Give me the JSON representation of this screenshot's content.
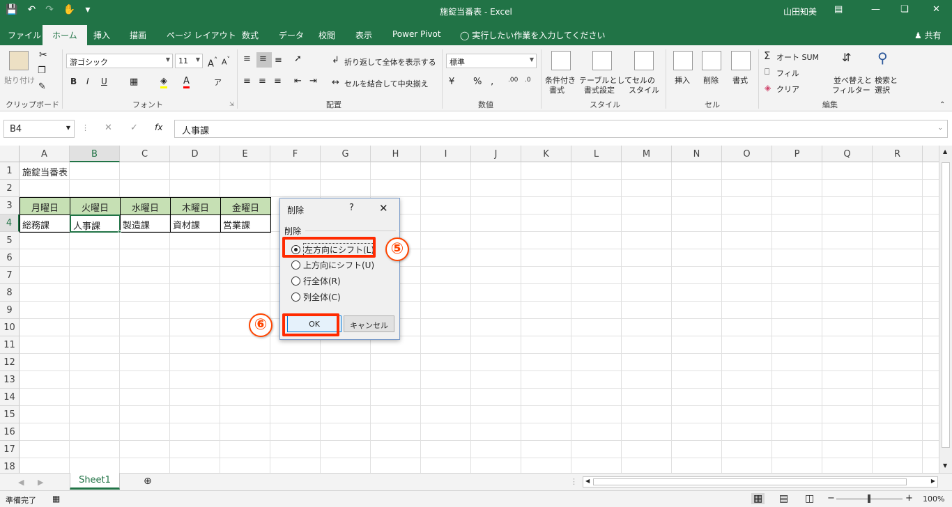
{
  "window": {
    "title": "施錠当番表 - Excel",
    "user": "山田知美"
  },
  "menu": [
    {
      "label": "ファイル",
      "active": false
    },
    {
      "label": "ホーム",
      "active": true
    },
    {
      "label": "挿入",
      "active": false
    },
    {
      "label": "描画",
      "active": false
    },
    {
      "label": "ページ レイアウト",
      "active": false
    },
    {
      "label": "数式",
      "active": false
    },
    {
      "label": "データ",
      "active": false
    },
    {
      "label": "校閲",
      "active": false
    },
    {
      "label": "表示",
      "active": false
    },
    {
      "label": "Power Pivot",
      "active": false
    }
  ],
  "tellme": "実行したい作業を入力してください",
  "share": "共有",
  "ribbon": {
    "paste": "貼り付け",
    "font_name": "游ゴシック",
    "font_size": "11",
    "wrap_text": "折り返して全体を表示する",
    "merge_center": "セルを結合して中央揃え",
    "number_format": "標準",
    "cond_format": [
      "条件付き",
      "書式"
    ],
    "table_format": [
      "テーブルとして",
      "書式設定"
    ],
    "cell_style": [
      "セルの",
      "スタイル"
    ],
    "insert": "挿入",
    "delete": "削除",
    "format": "書式",
    "autosum": "オート SUM",
    "fill": "フィル",
    "clear": "クリア",
    "sort_filter": [
      "並べ替えと",
      "フィルター"
    ],
    "find_select": [
      "検索と",
      "選択"
    ],
    "groups": {
      "clipboard": "クリップボード",
      "font": "フォント",
      "alignment": "配置",
      "number": "数値",
      "styles": "スタイル",
      "cells": "セル",
      "editing": "編集"
    }
  },
  "formula": {
    "namebox": "B4",
    "content": "人事課"
  },
  "columns": [
    "A",
    "B",
    "C",
    "D",
    "E",
    "F",
    "G",
    "H",
    "I",
    "J",
    "K",
    "L",
    "M",
    "N",
    "O",
    "P",
    "Q",
    "R"
  ],
  "rows": [
    "1",
    "2",
    "3",
    "4",
    "5",
    "6",
    "7",
    "8",
    "9",
    "10",
    "11",
    "12",
    "13",
    "14",
    "15",
    "16",
    "17",
    "18"
  ],
  "sheet": {
    "title": "施錠当番表",
    "headers": [
      "月曜日",
      "火曜日",
      "水曜日",
      "木曜日",
      "金曜日"
    ],
    "values": [
      "総務課",
      "人事課",
      "製造課",
      "資材課",
      "営業課"
    ]
  },
  "dialog": {
    "title": "削除",
    "help": "?",
    "group_label": "削除",
    "options": [
      {
        "label": "左方向にシフト(L)",
        "checked": true
      },
      {
        "label": "上方向にシフト(U)",
        "checked": false
      },
      {
        "label": "行全体(R)",
        "checked": false
      },
      {
        "label": "列全体(C)",
        "checked": false
      }
    ],
    "ok": "OK",
    "cancel": "キャンセル"
  },
  "annotations": {
    "step5": "⑤",
    "step6": "⑥"
  },
  "sheet_tab": "Sheet1",
  "status": {
    "ready": "準備完了",
    "zoom": "100%"
  },
  "colors": {
    "excel_green": "#217346",
    "header_fill": "#c6e0b4",
    "highlight": "#ff2a00"
  }
}
